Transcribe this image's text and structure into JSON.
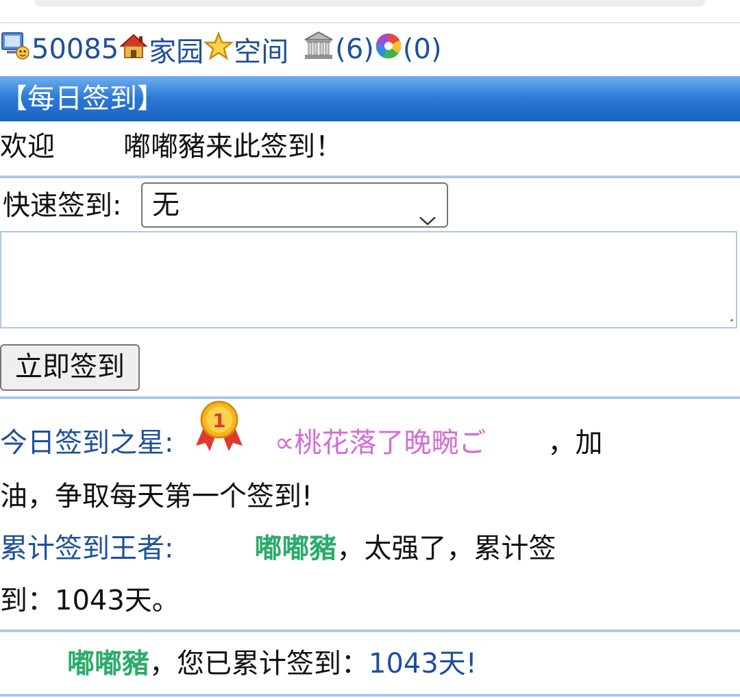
{
  "topbar": {
    "user_id": "50085",
    "home_label": "家园",
    "space_label": "空间",
    "bank_count": "(6)",
    "album_count": "(0)"
  },
  "section": {
    "title": "【每日签到】"
  },
  "welcome": {
    "prefix": "欢迎",
    "username": "嘟嘟豬",
    "suffix": "来此签到！"
  },
  "form": {
    "quick_label": "快速签到:",
    "select_value": "无",
    "textarea_value": "",
    "submit_label": "立即签到"
  },
  "stats": {
    "star_label": "今日签到之星:",
    "star_name": "∝桃花落了晚畹ご",
    "star_sep": "，加",
    "star_line2": "油，争取每天第一个签到!",
    "king_label": "累计签到王者:",
    "king_name": "嘟嘟豬",
    "king_text": "，太强了，累计签",
    "king_line2": "到：1043天。"
  },
  "summary": {
    "name": "嘟嘟豬",
    "text": "，您已累计签到：",
    "days": "1043天!"
  },
  "colors": {
    "link_blue": "#1d4f9a",
    "header_blue": "#2c79d5",
    "pink_name": "#d46bd6",
    "green_name": "#2bac6a",
    "separator": "#a9c9ec"
  },
  "icons": [
    "pc-user-icon",
    "home-icon",
    "star-icon",
    "bank-icon",
    "album-icon",
    "gold-medal-icon",
    "chevron-down-icon",
    "resize-grip-icon"
  ]
}
